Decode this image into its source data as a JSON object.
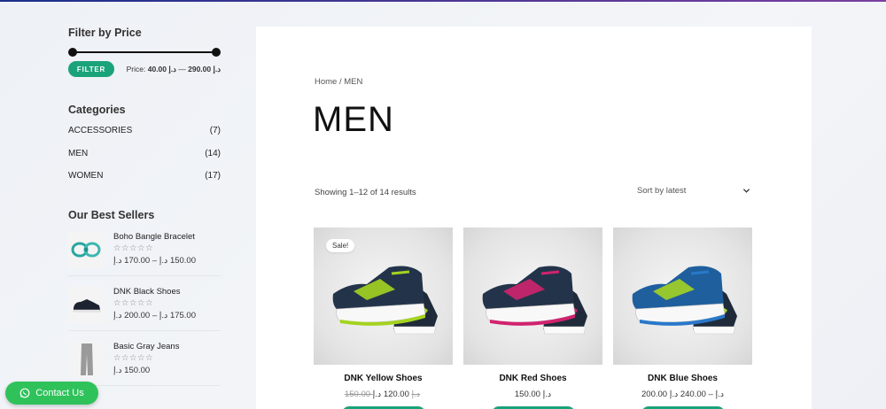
{
  "sidebar": {
    "price_filter": {
      "title": "Filter by Price",
      "button_label": "FILTER",
      "price_prefix": "Price:",
      "price_min": "د.إ 40.00",
      "price_sep": " — ",
      "price_max": "د.إ 290.00"
    },
    "categories": {
      "title": "Categories",
      "items": [
        {
          "label": "ACCESSORIES",
          "count": "(7)"
        },
        {
          "label": "MEN",
          "count": "(14)"
        },
        {
          "label": "WOMEN",
          "count": "(17)"
        }
      ]
    },
    "best_sellers": {
      "title": "Our Best Sellers",
      "items": [
        {
          "name": "Boho Bangle Bracelet",
          "stars": "☆☆☆☆☆",
          "price": "150.00 د.إ – 170.00 د.إ"
        },
        {
          "name": "DNK Black Shoes",
          "stars": "☆☆☆☆☆",
          "price": "175.00 د.إ – 200.00 د.إ"
        },
        {
          "name": "Basic Gray Jeans",
          "stars": "☆☆☆☆☆",
          "price": "150.00 د.إ"
        }
      ]
    }
  },
  "main": {
    "breadcrumb": "Home / MEN",
    "title": "MEN",
    "result_count": "Showing 1–12 of 14 results",
    "sort_label": "Sort by latest",
    "products": [
      {
        "name": "DNK Yellow Shoes",
        "badge": "Sale!",
        "old_price": "150.00 د.إ",
        "price": "120.00 د.إ",
        "accent": "#a4d321"
      },
      {
        "name": "DNK Red Shoes",
        "badge": "",
        "old_price": "",
        "price": "150.00 د.إ",
        "accent": "#d0236e"
      },
      {
        "name": "DNK Blue Shoes",
        "badge": "",
        "old_price": "",
        "price": "200.00 د.إ – 240.00 د.إ",
        "accent": "#2a78c9"
      }
    ]
  },
  "contact_button": {
    "label": "Contact Us"
  },
  "colors": {
    "brand_green": "#1aa37a",
    "whatsapp_green": "#2fc25b"
  }
}
